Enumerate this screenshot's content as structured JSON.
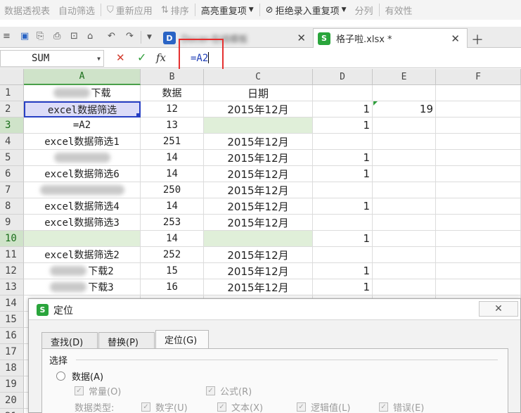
{
  "ribbon": {
    "items": [
      {
        "label": "数据透视表",
        "icon": null,
        "dropdown": false,
        "strong": false
      },
      {
        "label": "自动筛选",
        "icon": null,
        "dropdown": false,
        "strong": false
      },
      {
        "label": "重新应用",
        "icon": "filter-icon",
        "dropdown": false,
        "strong": false
      },
      {
        "label": "排序",
        "icon": "sort-icon",
        "dropdown": false,
        "strong": false
      },
      {
        "label": "高亮重复项",
        "icon": null,
        "dropdown": true,
        "strong": true
      },
      {
        "label": "拒绝录入重复项",
        "icon": "reject-icon",
        "dropdown": true,
        "strong": true
      },
      {
        "label": "分列",
        "icon": null,
        "dropdown": false,
        "strong": false
      },
      {
        "label": "有效性",
        "icon": null,
        "dropdown": false,
        "strong": false
      }
    ]
  },
  "tabs": [
    {
      "label": "Docer-在线模板",
      "icon_text": "D",
      "icon_color": "#2a64c5",
      "active": false
    },
    {
      "label": "格子啦.xlsx *",
      "icon_text": "S",
      "icon_color": "#2aa53c",
      "active": true
    }
  ],
  "formula_bar": {
    "name_box": "SUM",
    "content": "=A2"
  },
  "columns": [
    "A",
    "B",
    "C",
    "D",
    "E",
    "F"
  ],
  "selected_column": "A",
  "rows": [
    {
      "num": "1",
      "a": "下载",
      "b": "数据",
      "c": "日期",
      "d": "",
      "e": ""
    },
    {
      "num": "2",
      "a": "excel数据筛选",
      "b": "12",
      "c": "2015年12月",
      "d": "1",
      "e": "19"
    },
    {
      "num": "3",
      "a": "=A2",
      "b": "13",
      "c": "",
      "d": "1",
      "e": ""
    },
    {
      "num": "4",
      "a": "excel数据筛选1",
      "b": "251",
      "c": "2015年12月",
      "d": "",
      "e": ""
    },
    {
      "num": "5",
      "a": "",
      "b": "14",
      "c": "2015年12月",
      "d": "1",
      "e": ""
    },
    {
      "num": "6",
      "a": "excel数据筛选6",
      "b": "14",
      "c": "2015年12月",
      "d": "1",
      "e": ""
    },
    {
      "num": "7",
      "a": "",
      "b": "250",
      "c": "2015年12月",
      "d": "",
      "e": ""
    },
    {
      "num": "8",
      "a": "excel数据筛选4",
      "b": "14",
      "c": "2015年12月",
      "d": "1",
      "e": ""
    },
    {
      "num": "9",
      "a": "excel数据筛选3",
      "b": "253",
      "c": "2015年12月",
      "d": "",
      "e": ""
    },
    {
      "num": "10",
      "a": "",
      "b": "14",
      "c": "",
      "d": "1",
      "e": ""
    },
    {
      "num": "11",
      "a": "excel数据筛选2",
      "b": "252",
      "c": "2015年12月",
      "d": "",
      "e": ""
    },
    {
      "num": "12",
      "a": "下载2",
      "b": "15",
      "c": "2015年12月",
      "d": "1",
      "e": ""
    },
    {
      "num": "13",
      "a": "下载3",
      "b": "16",
      "c": "2015年12月",
      "d": "1",
      "e": ""
    },
    {
      "num": "14",
      "a": "",
      "b": "",
      "c": "",
      "d": "",
      "e": ""
    },
    {
      "num": "15",
      "a": "",
      "b": "",
      "c": "",
      "d": "",
      "e": ""
    },
    {
      "num": "16",
      "a": "",
      "b": "",
      "c": "",
      "d": "",
      "e": ""
    },
    {
      "num": "17",
      "a": "",
      "b": "",
      "c": "",
      "d": "",
      "e": ""
    },
    {
      "num": "18",
      "a": "",
      "b": "",
      "c": "",
      "d": "",
      "e": ""
    },
    {
      "num": "19",
      "a": "",
      "b": "",
      "c": "",
      "d": "",
      "e": ""
    },
    {
      "num": "20",
      "a": "",
      "b": "",
      "c": "",
      "d": "",
      "e": ""
    },
    {
      "num": "21",
      "a": "",
      "b": "",
      "c": "",
      "d": "",
      "e": ""
    }
  ],
  "dialog": {
    "title": "定位",
    "logo_text": "S",
    "tabs": [
      "查找(D)",
      "替换(P)",
      "定位(G)"
    ],
    "group_label": "选择",
    "radio_data": "数据(A)",
    "chk_const": "常量(O)",
    "chk_formula": "公式(R)",
    "data_type_label": "数据类型:",
    "chk_number": "数字(U)",
    "chk_text": "文本(X)",
    "chk_logic": "逻辑值(L)",
    "chk_error": "错误(E)"
  },
  "colors": {
    "selection": "#2840c4",
    "highlight": "#e0efd9",
    "annotation": "#e53030"
  }
}
